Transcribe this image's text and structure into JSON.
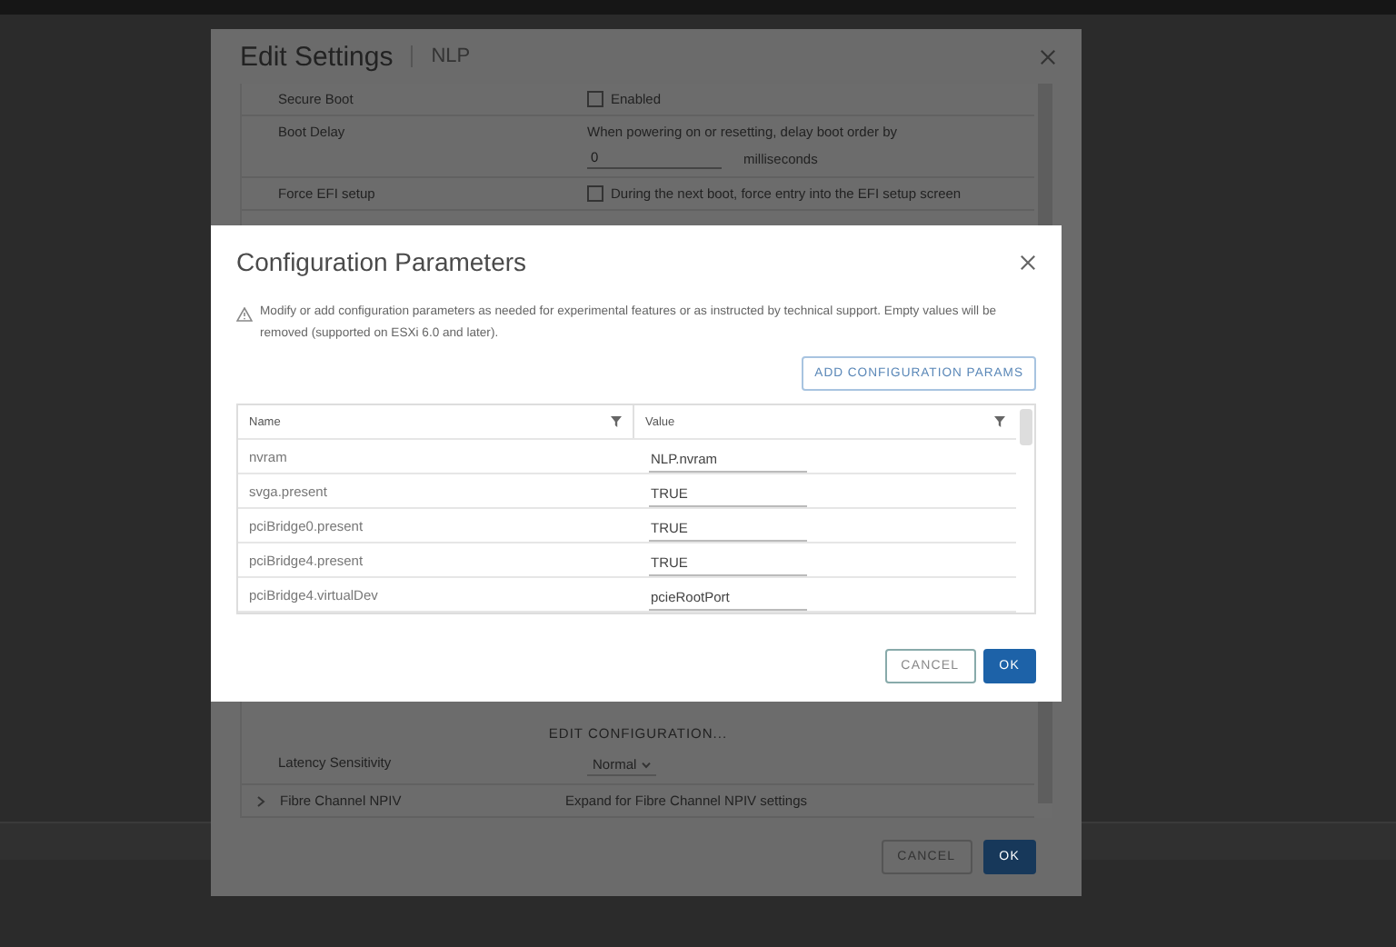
{
  "edit_settings": {
    "title": "Edit Settings",
    "subtitle": "NLP",
    "top_rows": [
      {
        "kind": "checkbox",
        "label": "Secure Boot",
        "text": "Enabled",
        "checked": false
      },
      {
        "kind": "delay",
        "label": "Boot Delay",
        "text": "When powering on or resetting, delay boot order by",
        "value": "0",
        "unit": "milliseconds"
      },
      {
        "kind": "checkbox",
        "label": "Force EFI setup",
        "text": "During the next boot, force entry into the EFI setup screen",
        "checked": false
      }
    ],
    "edit_configuration_button": "EDIT CONFIGURATION...",
    "bottom_rows": [
      {
        "kind": "select",
        "label": "Latency Sensitivity",
        "value": "Normal"
      },
      {
        "kind": "expander",
        "label": "Fibre Channel NPIV",
        "text": "Expand for Fibre Channel NPIV settings",
        "expanded": false
      }
    ],
    "buttons": {
      "cancel": "CANCEL",
      "ok": "OK"
    }
  },
  "config_dialog": {
    "title": "Configuration Parameters",
    "notice": "Modify or add configuration parameters as needed for experimental features or as instructed by technical support. Empty values will be removed (supported on ESXi 6.0 and later).",
    "add_button": "ADD CONFIGURATION PARAMS",
    "table": {
      "columns": [
        "Name",
        "Value"
      ],
      "rows": [
        {
          "name": "nvram",
          "value": "NLP.nvram"
        },
        {
          "name": "svga.present",
          "value": "TRUE"
        },
        {
          "name": "pciBridge0.present",
          "value": "TRUE"
        },
        {
          "name": "pciBridge4.present",
          "value": "TRUE"
        },
        {
          "name": "pciBridge4.virtualDev",
          "value": "pcieRootPort"
        }
      ]
    },
    "buttons": {
      "cancel": "CANCEL",
      "ok": "OK"
    }
  }
}
